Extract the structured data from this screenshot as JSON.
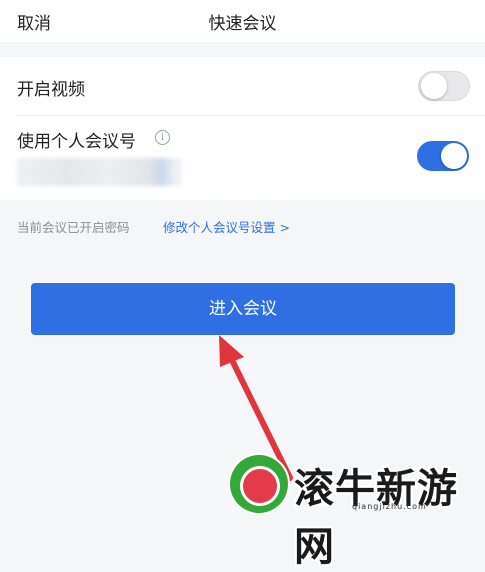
{
  "header": {
    "cancel_label": "取消",
    "title": "快速会议"
  },
  "settings": {
    "video_label": "开启视频",
    "video_on": false,
    "personal_id_label": "使用个人会议号",
    "personal_id_on": true
  },
  "hint": {
    "text": "当前会议已开启密码",
    "link_label": "修改个人会议号设置 >"
  },
  "join_button_label": "进入会议",
  "watermark": {
    "text": "滚牛新游网",
    "url": "qiangjizhu.com"
  },
  "colors": {
    "accent": "#2f6fe4",
    "arrow": "#e0353d"
  }
}
